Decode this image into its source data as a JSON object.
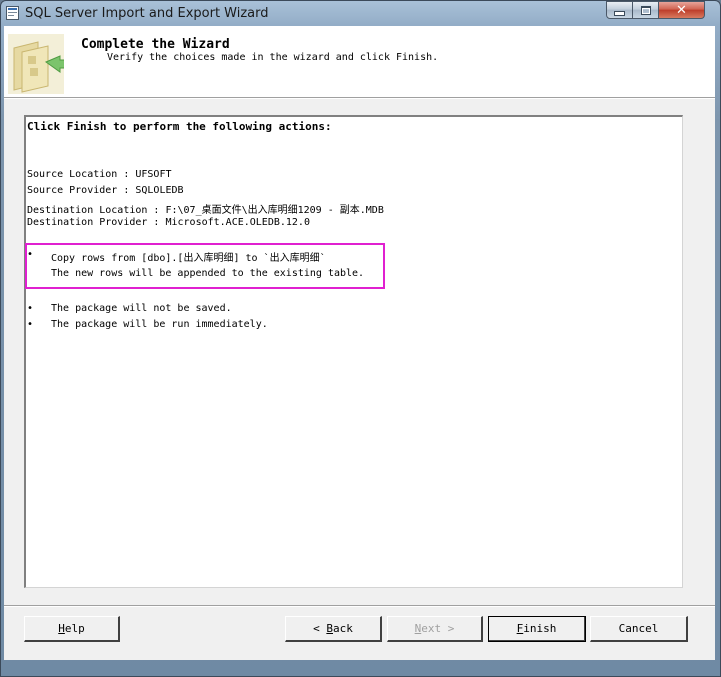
{
  "window": {
    "title": "SQL Server Import and Export Wizard",
    "controls": {
      "minimize": "minimize",
      "maximize": "maximize",
      "close": "✕"
    }
  },
  "header": {
    "title": "Complete the Wizard",
    "subtitle": "Verify the choices made in the wizard and click Finish."
  },
  "report": {
    "intro": "Click Finish to perform the following actions:",
    "source_location": "Source Location : UFSOFT",
    "source_provider": "Source Provider : SQLOLEDB",
    "destination_location": "Destination Location : F:\\07_桌面文件\\出入库明细1209 - 副本.MDB",
    "destination_provider": "Destination Provider : Microsoft.ACE.OLEDB.12.0",
    "actions": [
      {
        "bullet": "•",
        "line1": "Copy rows from [dbo].[出入库明细] to `出入库明细`",
        "line2": "The new rows will be appended to the existing table."
      },
      {
        "bullet": "•",
        "line1": "The package will not be saved."
      },
      {
        "bullet": "•",
        "line1": "The package will be run immediately."
      }
    ]
  },
  "buttons": {
    "help": {
      "mnemonic": "H",
      "rest": "elp",
      "enabled": true
    },
    "back": {
      "arrow": "<",
      "mnemonic": "B",
      "rest": "ack",
      "enabled": true
    },
    "next": {
      "rest_pre": "",
      "mnemonic": "N",
      "rest": "ext",
      "arrow": ">",
      "enabled": false
    },
    "finish": {
      "mnemonic": "F",
      "rest": "inish",
      "enabled": true,
      "default": true
    },
    "cancel": {
      "label": "Cancel",
      "enabled": true
    }
  },
  "icons": {
    "app": "wizard-app-icon",
    "header": "wizard-folder-arrow-icon"
  },
  "colors": {
    "highlight_border": "#e020d0",
    "close_button": "#c8442f"
  }
}
